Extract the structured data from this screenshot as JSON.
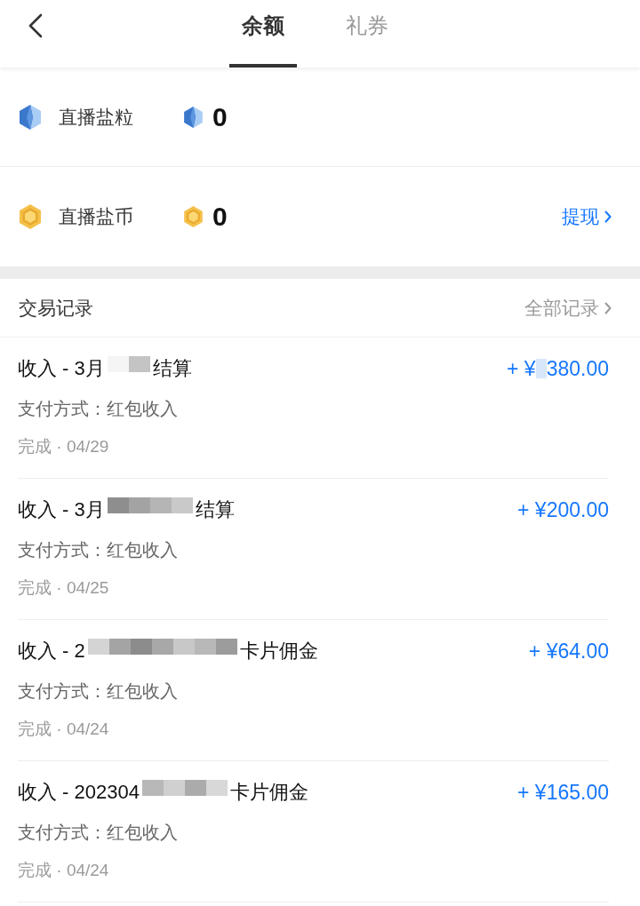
{
  "tabs": [
    {
      "label": "余额",
      "selected": true
    },
    {
      "label": "礼券",
      "selected": false
    }
  ],
  "balances": [
    {
      "kind": "gem",
      "label": "直播盐粒",
      "amount": "0"
    },
    {
      "kind": "coin",
      "label": "直播盐币",
      "amount": "0",
      "action": "提现"
    }
  ],
  "records": {
    "title": "交易记录",
    "link": "全部记录"
  },
  "transactions": [
    {
      "title": [
        {
          "kind": "text",
          "text": "收入 - 3月"
        },
        {
          "kind": "mosaic",
          "tiles": [
            {
              "color": "#f5f5f5"
            },
            {
              "color": "#c4c4c4"
            }
          ]
        },
        {
          "kind": "text",
          "text": "结算"
        }
      ],
      "method": "支付方式：红包收入",
      "status": "完成 · 04/29",
      "amount": [
        {
          "kind": "text",
          "text": "+ ¥"
        },
        {
          "kind": "mosaic",
          "tiles": [
            {
              "color": "#d9e7fb"
            }
          ]
        },
        {
          "kind": "text",
          "text": "380.00"
        }
      ]
    },
    {
      "title": [
        {
          "kind": "text",
          "text": "收入 - 3月"
        },
        {
          "kind": "mosaic",
          "tiles": [
            {
              "color": "#8e8e8e"
            },
            {
              "color": "#a3a3a3"
            },
            {
              "color": "#b5b5b5"
            },
            {
              "color": "#c9c9c9"
            }
          ]
        },
        {
          "kind": "text",
          "text": "结算"
        }
      ],
      "method": "支付方式：红包收入",
      "status": "完成 · 04/25",
      "amount": [
        {
          "kind": "text",
          "text": "+ ¥200.00"
        }
      ]
    },
    {
      "title": [
        {
          "kind": "text",
          "text": "收入 - 2"
        },
        {
          "kind": "mosaic",
          "tiles": [
            {
              "color": "#d4d4d4"
            },
            {
              "color": "#a4a4a4"
            },
            {
              "color": "#8c8c8c"
            },
            {
              "color": "#a8a8a8"
            },
            {
              "color": "#c8c8c8"
            },
            {
              "color": "#b8b8b8"
            },
            {
              "color": "#9c9c9c"
            }
          ]
        },
        {
          "kind": "text",
          "text": "卡片佣金"
        }
      ],
      "method": "支付方式：红包收入",
      "status": "完成 · 04/24",
      "amount": [
        {
          "kind": "text",
          "text": "+ ¥64.00"
        }
      ]
    },
    {
      "title": [
        {
          "kind": "text",
          "text": "收入 - 202304"
        },
        {
          "kind": "mosaic",
          "tiles": [
            {
              "color": "#b8b8b8"
            },
            {
              "color": "#d0d0d0"
            },
            {
              "color": "#ababab"
            },
            {
              "color": "#d8d8d8"
            }
          ]
        },
        {
          "kind": "text",
          "text": "卡片佣金"
        }
      ],
      "method": "支付方式：红包收入",
      "status": "完成 · 04/24",
      "amount": [
        {
          "kind": "text",
          "text": "+ ¥165.00"
        }
      ]
    }
  ]
}
